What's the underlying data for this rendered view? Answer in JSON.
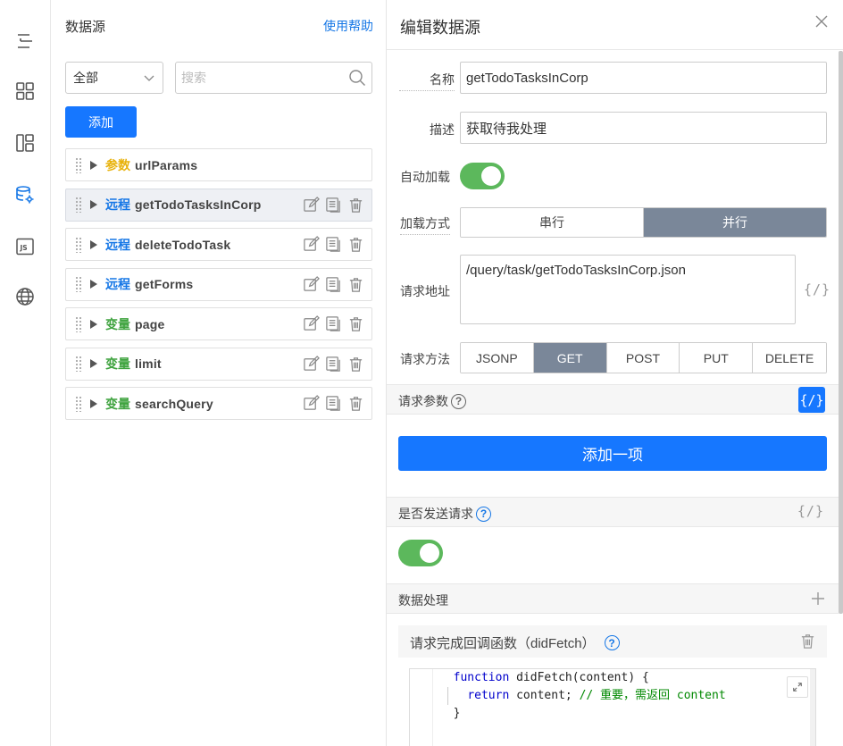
{
  "datasource_panel": {
    "title": "数据源",
    "help_link": "使用帮助",
    "filter_select": "全部",
    "search_placeholder": "搜索",
    "add_button": "添加",
    "items": [
      {
        "type": "参数",
        "type_kind": "param",
        "name": "urlParams",
        "active": false,
        "actions": false
      },
      {
        "type": "远程",
        "type_kind": "remote",
        "name": "getTodoTasksInCorp",
        "active": true,
        "actions": true
      },
      {
        "type": "远程",
        "type_kind": "remote",
        "name": "deleteTodoTask",
        "active": false,
        "actions": true
      },
      {
        "type": "远程",
        "type_kind": "remote",
        "name": "getForms",
        "active": false,
        "actions": true
      },
      {
        "type": "变量",
        "type_kind": "var",
        "name": "page",
        "active": false,
        "actions": true
      },
      {
        "type": "变量",
        "type_kind": "var",
        "name": "limit",
        "active": false,
        "actions": true
      },
      {
        "type": "变量",
        "type_kind": "var",
        "name": "searchQuery",
        "active": false,
        "actions": true
      }
    ]
  },
  "editor": {
    "title": "编辑数据源",
    "name_label": "名称",
    "name_value": "getTodoTasksInCorp",
    "desc_label": "描述",
    "desc_value": "获取待我处理",
    "autoload_label": "自动加载",
    "autoload_on": true,
    "load_mode_label": "加载方式",
    "load_modes": [
      "串行",
      "并行"
    ],
    "load_mode_selected": "并行",
    "url_label": "请求地址",
    "url_value": "/query/task/getTodoTasksInCorp.json",
    "fx_text": "{/}",
    "method_label": "请求方法",
    "methods": [
      "JSONP",
      "GET",
      "POST",
      "PUT",
      "DELETE"
    ],
    "method_selected": "GET",
    "params_section": "请求参数",
    "add_item_button": "添加一项",
    "send_section": "是否发送请求",
    "send_on": true,
    "process_section": "数据处理",
    "callback_label": "请求完成回调函数（didFetch）",
    "code_lines": [
      {
        "kw": "function",
        "rest": " didFetch(content) {",
        "indent": "  "
      },
      {
        "kw": "return",
        "rest": " content; ",
        "comment": "// 重要，需返回 content",
        "indent": "    "
      },
      {
        "kw": "",
        "rest": "}",
        "indent": "  "
      }
    ]
  },
  "colors": {
    "primary": "#1677ff",
    "toggle_on": "#5cb85c",
    "segment_selected": "#7a8799",
    "type_param": "#e8b20c",
    "type_remote": "#1677e6",
    "type_var": "#3fa33f"
  }
}
